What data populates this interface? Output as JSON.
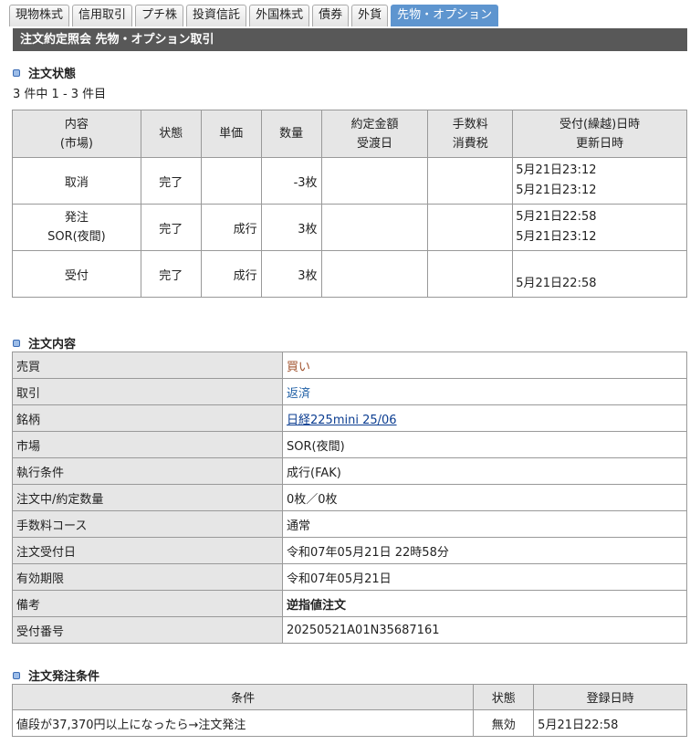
{
  "tabs": [
    {
      "label": "現物株式",
      "active": false
    },
    {
      "label": "信用取引",
      "active": false
    },
    {
      "label": "プチ株",
      "active": false
    },
    {
      "label": "投資信託",
      "active": false
    },
    {
      "label": "外国株式",
      "active": false
    },
    {
      "label": "債券",
      "active": false
    },
    {
      "label": "外貨",
      "active": false
    },
    {
      "label": "先物・オプション",
      "active": true
    }
  ],
  "page_title": "注文約定照会 先物・オプション取引",
  "status_section": {
    "title": "注文状態",
    "count_text": "3 件中 1 - 3 件目",
    "headers": {
      "content_1": "内容",
      "content_2": "(市場)",
      "state": "状態",
      "price": "単価",
      "qty": "数量",
      "amount_1": "約定金額",
      "amount_2": "受渡日",
      "fee_1": "手数料",
      "fee_2": "消費税",
      "time_1": "受付(繰越)日時",
      "time_2": "更新日時"
    },
    "rows": [
      {
        "content_1": "取消",
        "content_2": "",
        "state": "完了",
        "price": "",
        "qty": "-3枚",
        "time_1": "5月21日23:12",
        "time_2": "5月21日23:12"
      },
      {
        "content_1": "発注",
        "content_2": "SOR(夜間)",
        "state": "完了",
        "price": "成行",
        "qty": "3枚",
        "time_1": "5月21日22:58",
        "time_2": "5月21日23:12"
      },
      {
        "content_1": "受付",
        "content_2": "",
        "state": "完了",
        "price": "成行",
        "qty": "3枚",
        "time_1": "",
        "time_2": "5月21日22:58"
      }
    ]
  },
  "detail_section": {
    "title": "注文内容",
    "rows": {
      "side": {
        "key": "売買",
        "value": "買い"
      },
      "trade": {
        "key": "取引",
        "value": "返済"
      },
      "symbol": {
        "key": "銘柄",
        "value": "日経225mini 25/06"
      },
      "market": {
        "key": "市場",
        "value": "SOR(夜間)"
      },
      "exec": {
        "key": "執行条件",
        "value": "成行(FAK)"
      },
      "qty": {
        "key": "注文中/約定数量",
        "value": "0枚／0枚"
      },
      "course": {
        "key": "手数料コース",
        "value": "通常"
      },
      "order_date": {
        "key": "注文受付日",
        "value": "令和07年05月21日 22時58分"
      },
      "expiry": {
        "key": "有効期限",
        "value": "令和07年05月21日"
      },
      "note": {
        "key": "備考",
        "value": "逆指値注文"
      },
      "receipt": {
        "key": "受付番号",
        "value": "20250521A01N35687161"
      }
    }
  },
  "condition_section": {
    "title": "注文発注条件",
    "headers": {
      "condition": "条件",
      "state": "状態",
      "date": "登録日時"
    },
    "row": {
      "condition": "値段が37,370円以上になったら→注文発注",
      "state": "無効",
      "date": "5月21日22:58"
    }
  },
  "colors": {
    "title_bar": "#585858",
    "active_tab": "#5e95cf",
    "header_bg": "#e6e6e6",
    "buy": "#a0522d",
    "repay": "#1f5fa5"
  }
}
